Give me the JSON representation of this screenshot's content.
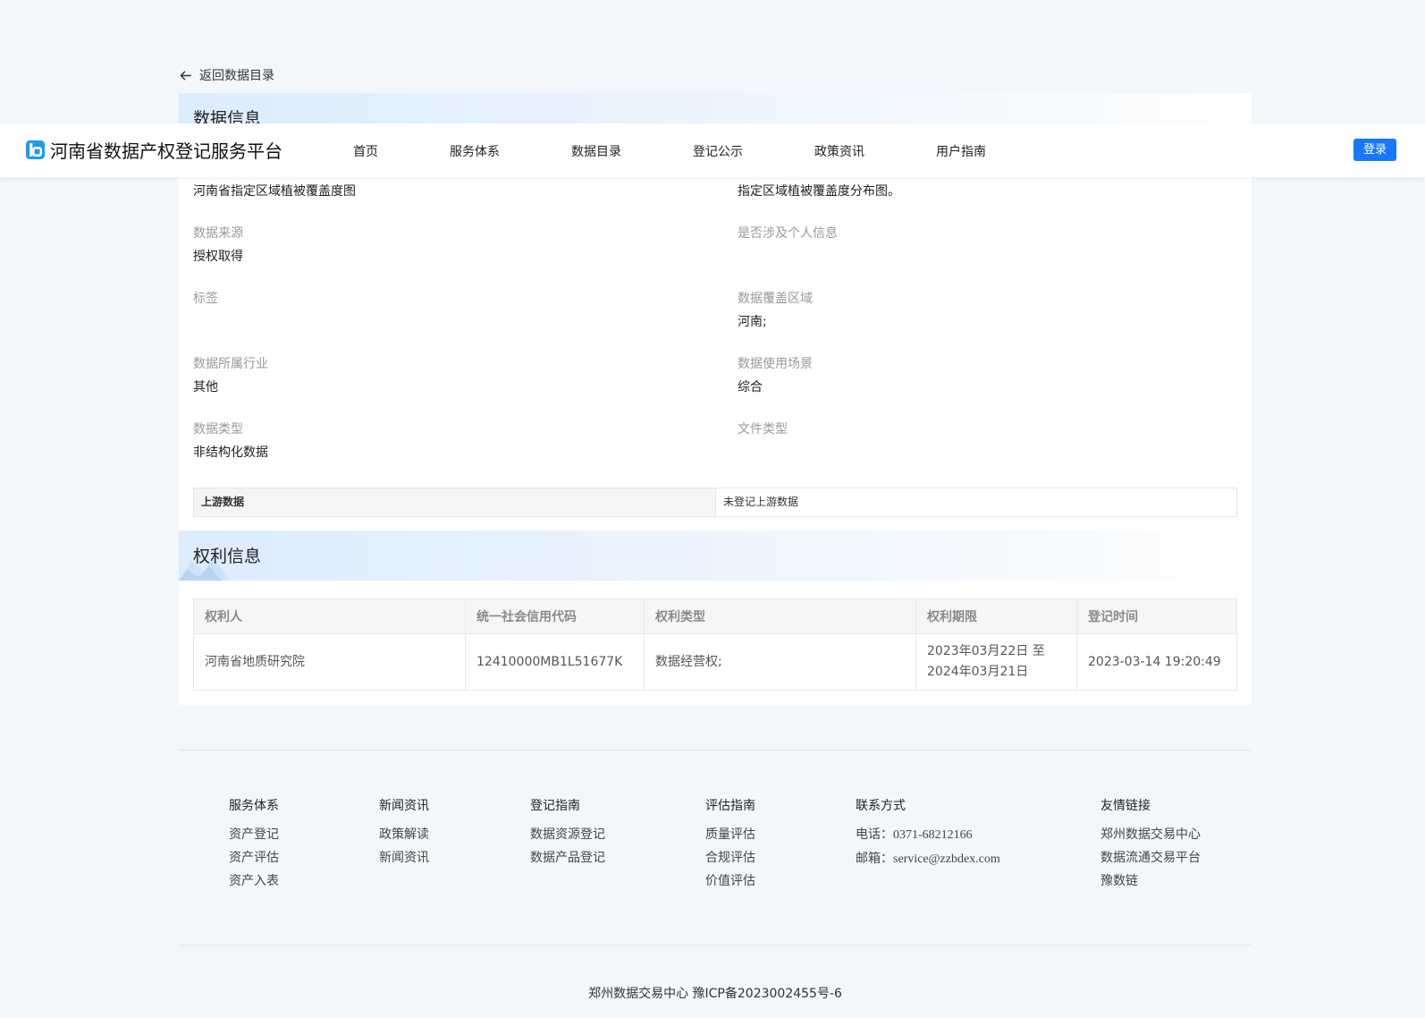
{
  "back_link": "返回数据目录",
  "header": {
    "brand": "河南省数据产权登记服务平台",
    "nav": [
      "首页",
      "服务体系",
      "数据目录",
      "登记公示",
      "政策资讯",
      "用户指南"
    ],
    "login": "登录"
  },
  "data_info": {
    "title": "数据信息",
    "name_value": "河南省指定区域植被覆盖度图",
    "desc_value": "指定区域植被覆盖度分布图。",
    "source_label": "数据来源",
    "source_value": "授权取得",
    "personal_label": "是否涉及个人信息",
    "personal_value": "",
    "tags_label": "标签",
    "tags_value": "",
    "coverage_label": "数据覆盖区域",
    "coverage_value": "河南;",
    "industry_label": "数据所属行业",
    "industry_value": "其他",
    "scenario_label": "数据使用场景",
    "scenario_value": "综合",
    "type_label": "数据类型",
    "type_value": "非结构化数据",
    "file_type_label": "文件类型",
    "file_type_value": "",
    "upstream_label": "上游数据",
    "upstream_value": "未登记上游数据"
  },
  "rights_info": {
    "title": "权利信息",
    "columns": [
      "权利人",
      "统一社会信用代码",
      "权利类型",
      "权利期限",
      "登记时间"
    ],
    "rows": [
      {
        "holder": "河南省地质研究院",
        "credit_code": "12410000MB1L51677K",
        "right_type": "数据经营权;",
        "period_line1": "2023年03月22日 至",
        "period_line2": "2024年03月21日",
        "reg_time": "2023-03-14 19:20:49"
      }
    ]
  },
  "footer": {
    "columns": [
      {
        "title": "服务体系",
        "items": [
          "资产登记",
          "资产评估",
          "资产入表"
        ]
      },
      {
        "title": "新闻资讯",
        "items": [
          "政策解读",
          "新闻资讯"
        ]
      },
      {
        "title": "登记指南",
        "items": [
          "数据资源登记",
          "数据产品登记"
        ]
      },
      {
        "title": "评估指南",
        "items": [
          "质量评估",
          "合规评估",
          "价值评估"
        ]
      },
      {
        "title": "联系方式",
        "phone_label": "电话：",
        "phone": "0371-68212166",
        "email_label": "邮箱：",
        "email": "service@zzbdex.com"
      },
      {
        "title": "友情链接",
        "items": [
          "郑州数据交易中心",
          "数据流通交易平台",
          "豫数链"
        ]
      }
    ],
    "copyright": "郑州数据交易中心   豫ICP备2023002455号-6"
  },
  "colors": {
    "primary": "#1677ff",
    "page_bg": "#f3f6fb",
    "label_gray": "#999999"
  }
}
